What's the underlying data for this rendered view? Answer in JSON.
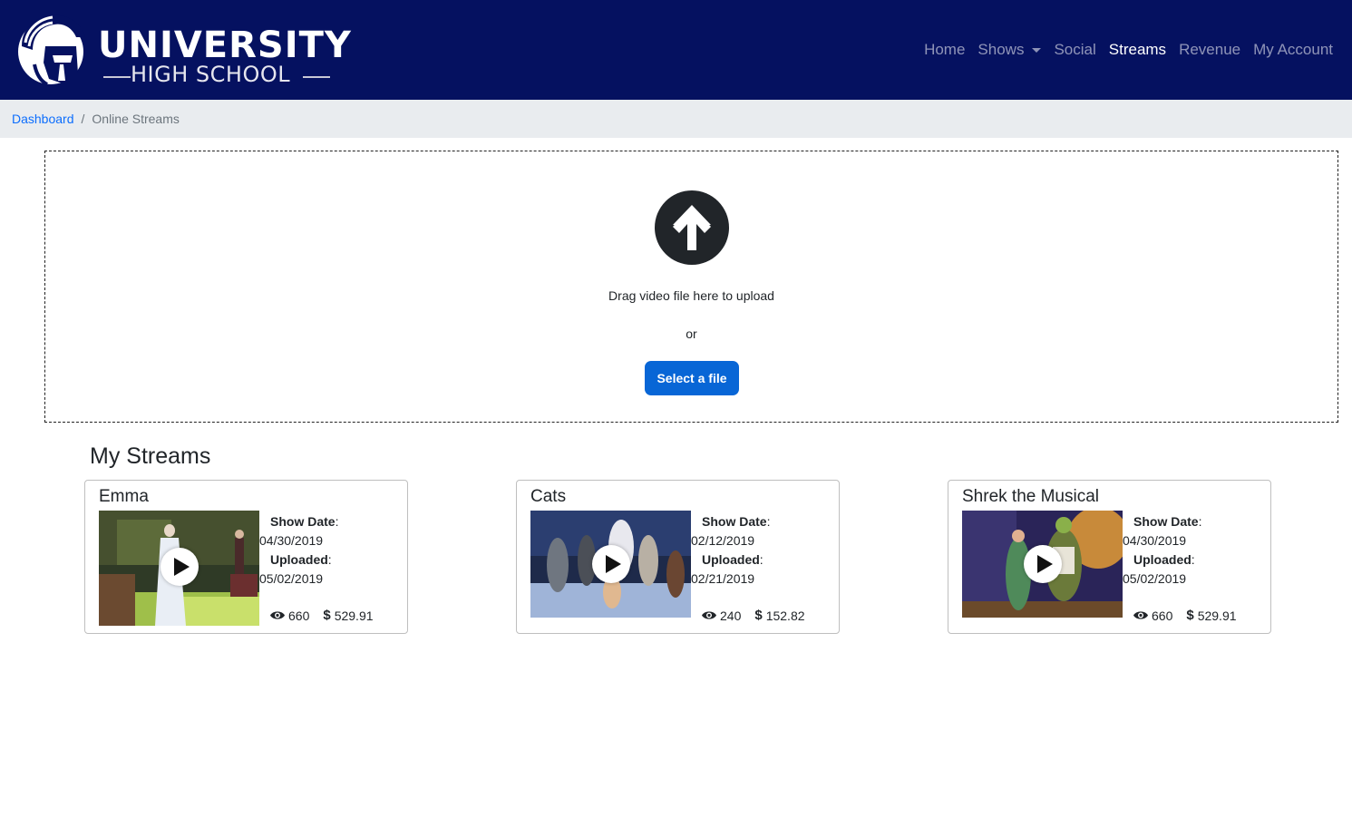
{
  "brand": {
    "line1": "UNIVERSITY",
    "line2": "HIGH SCHOOL",
    "colors": {
      "navbar": "#051160",
      "primary_button": "#0866d6",
      "link": "#0d6efd"
    }
  },
  "nav": {
    "home": "Home",
    "shows": "Shows",
    "social": "Social",
    "streams": "Streams",
    "revenue": "Revenue",
    "account": "My Account",
    "active": "Streams"
  },
  "breadcrumb": {
    "dashboard": "Dashboard",
    "separator": "/",
    "current": "Online Streams"
  },
  "upload": {
    "icon": "arrow-up-circle-icon",
    "drag_text": "Drag video file here to upload",
    "or_text": "or",
    "button_label": "Select a file"
  },
  "streams": {
    "title": "My Streams",
    "items": [
      {
        "title": "Emma",
        "show_date_label": "Show Date",
        "show_date": "04/30/2019",
        "uploaded_label": "Uploaded",
        "uploaded": "05/02/2019",
        "views": "660",
        "revenue": "529.91"
      },
      {
        "title": "Cats",
        "show_date_label": "Show Date",
        "show_date": "02/12/2019",
        "uploaded_label": "Uploaded",
        "uploaded": "02/21/2019",
        "views": "240",
        "revenue": "152.82"
      },
      {
        "title": "Shrek the Musical",
        "show_date_label": "Show Date",
        "show_date": "04/30/2019",
        "uploaded_label": "Uploaded",
        "uploaded": "05/02/2019",
        "views": "660",
        "revenue": "529.91"
      }
    ]
  }
}
